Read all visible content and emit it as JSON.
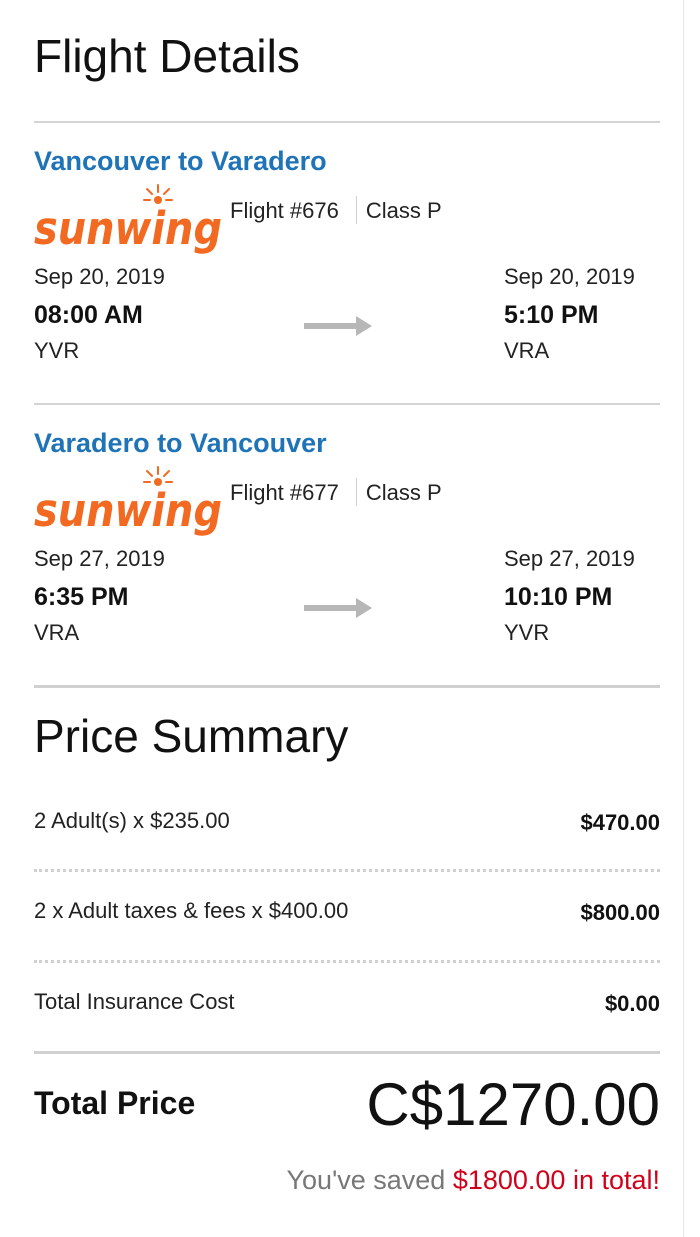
{
  "flight_details": {
    "title": "Flight Details",
    "legs": [
      {
        "route": "Vancouver to Varadero",
        "airline_logo": "sunwing",
        "flight_number": "Flight #676",
        "class": "Class P",
        "departure": {
          "date": "Sep 20, 2019",
          "time": "08:00 AM",
          "airport": "YVR"
        },
        "arrival": {
          "date": "Sep 20, 2019",
          "time": "5:10 PM",
          "airport": "VRA"
        },
        "arrow_icon": "arrow-right-icon"
      },
      {
        "route": "Varadero to Vancouver",
        "airline_logo": "sunwing",
        "flight_number": "Flight #677",
        "class": "Class P",
        "departure": {
          "date": "Sep 27, 2019",
          "time": "6:35 PM",
          "airport": "VRA"
        },
        "arrival": {
          "date": "Sep 27, 2019",
          "time": "10:10 PM",
          "airport": "YVR"
        },
        "arrow_icon": "arrow-right-icon"
      }
    ]
  },
  "price_summary": {
    "title": "Price Summary",
    "rows": [
      {
        "label": "2 Adult(s) x $235.00",
        "amount": "$470.00"
      },
      {
        "label": "2 x Adult taxes & fees x $400.00",
        "amount": "$800.00"
      },
      {
        "label": "Total Insurance Cost",
        "amount": "$0.00"
      }
    ],
    "total_label": "Total Price",
    "total_amount": "C$1270.00",
    "savings_prefix": "You've saved",
    "savings_amount": "$1800.00 in total!"
  },
  "colors": {
    "route_title": "#1f73b7",
    "logo_orange": "#f26a21",
    "savings_red": "#d0021b",
    "arrow_gray": "#b7b7b7"
  }
}
